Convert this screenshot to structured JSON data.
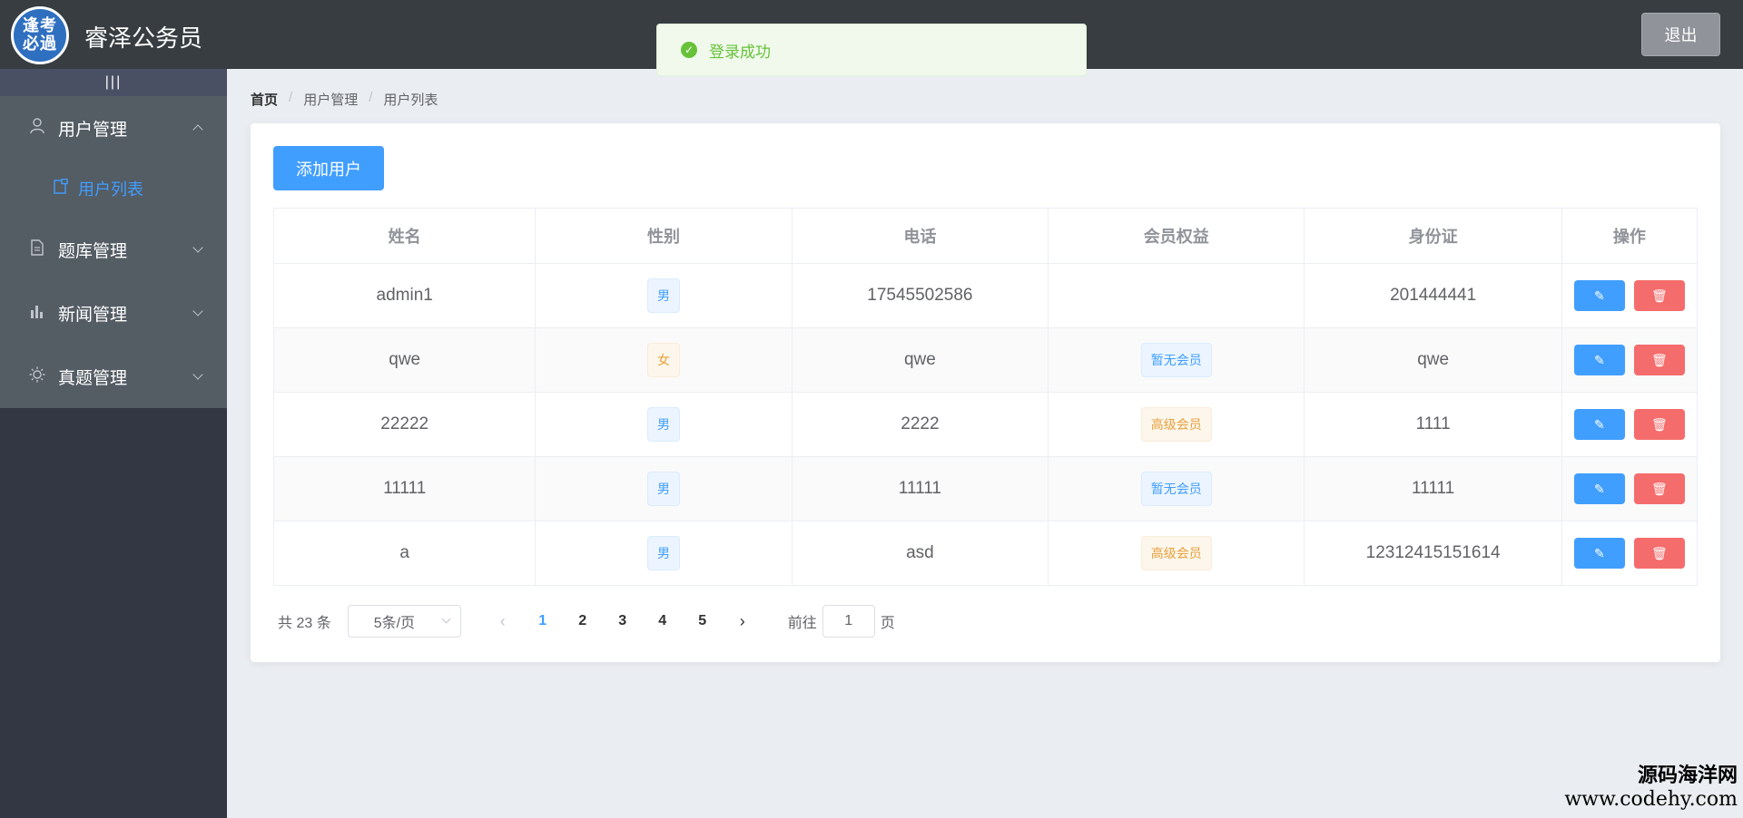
{
  "header": {
    "logo_text": "逢考必過",
    "app_title": "睿泽公务员",
    "logout_label": "退出"
  },
  "toast": {
    "message": "登录成功",
    "icon": "check-circle-icon"
  },
  "sidebar": {
    "collapse_toggle": "|||",
    "menu": [
      {
        "label": "用户管理",
        "icon": "user-icon",
        "expanded": true
      },
      {
        "label": "用户列表",
        "icon": "list-icon",
        "active": true
      },
      {
        "label": "题库管理",
        "icon": "document-icon"
      },
      {
        "label": "新闻管理",
        "icon": "bar-chart-icon"
      },
      {
        "label": "真题管理",
        "icon": "sun-icon"
      }
    ]
  },
  "breadcrumb": {
    "items": [
      "首页",
      "用户管理",
      "用户列表"
    ],
    "separator": "/"
  },
  "toolbar": {
    "add_label": "添加用户"
  },
  "table": {
    "columns": [
      "姓名",
      "性别",
      "电话",
      "会员权益",
      "身份证",
      "操作"
    ],
    "rows": [
      {
        "name": "admin1",
        "gender": "男",
        "phone": "17545502586",
        "membership": "",
        "id_card": "201444441"
      },
      {
        "name": "qwe",
        "gender": "女",
        "phone": "qwe",
        "membership": "暂无会员",
        "id_card": "qwe"
      },
      {
        "name": "22222",
        "gender": "男",
        "phone": "2222",
        "membership": "高级会员",
        "id_card": "1111"
      },
      {
        "name": "11111",
        "gender": "男",
        "phone": "11111",
        "membership": "暂无会员",
        "id_card": "11111"
      },
      {
        "name": "a",
        "gender": "男",
        "phone": "asd",
        "membership": "高级会员",
        "id_card": "12312415151614"
      }
    ]
  },
  "pagination": {
    "total_text": "共 23 条",
    "page_size": "5条/页",
    "prev": "‹",
    "next": "›",
    "pages": [
      "1",
      "2",
      "3",
      "4",
      "5"
    ],
    "current": "1",
    "goto_prefix": "前往",
    "goto_value": "1",
    "goto_suffix": "页"
  },
  "watermark": {
    "line1": "源码海洋网",
    "line2": "www.codehy.com"
  },
  "colors": {
    "header_bg": "#373d41",
    "sidebar_bg": "#333744",
    "primary": "#409eff",
    "danger": "#f56c6c",
    "success": "#67c23a"
  }
}
